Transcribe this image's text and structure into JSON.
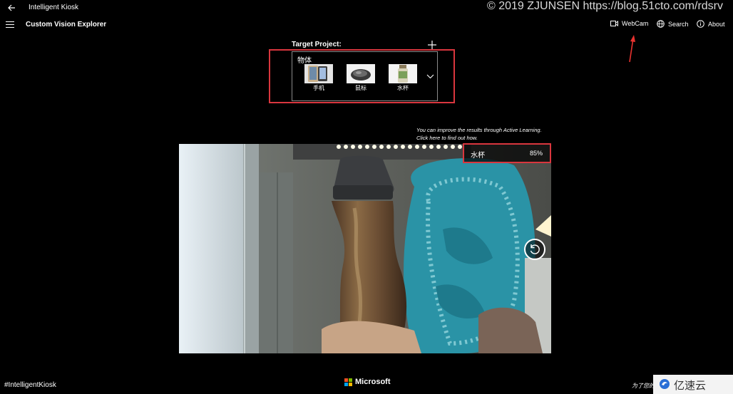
{
  "window": {
    "title": "Intelligent Kiosk",
    "watermark": "© 2019 ZJUNSEN https://blog.51cto.com/rdsrv"
  },
  "header": {
    "page_title": "Custom Vision Explorer",
    "nav": [
      {
        "label": "WebCam",
        "icon": "webcam-icon"
      },
      {
        "label": "Search",
        "icon": "globe-icon"
      },
      {
        "label": "About",
        "icon": "info-icon"
      }
    ]
  },
  "project": {
    "label": "Target Project:",
    "name": "物体",
    "tags": [
      {
        "label": "手机",
        "icon": "phone-thumbnail"
      },
      {
        "label": "鼠标",
        "icon": "mouse-thumbnail"
      },
      {
        "label": "水杯",
        "icon": "bottle-thumbnail"
      }
    ]
  },
  "active_learning": {
    "line1": "You can improve the results through Active Learning.",
    "line2": "Click here to find out how."
  },
  "result": {
    "label": "水杯",
    "score": "85%"
  },
  "footer": {
    "hashtag": "#IntelligentKiosk",
    "brand": "Microsoft",
    "note": "为了您的",
    "site": "亿速云"
  },
  "colors": {
    "highlight": "#d9363e",
    "ms_red": "#f25022",
    "ms_green": "#7fba00",
    "ms_blue": "#00a4ef",
    "ms_yellow": "#ffb900"
  }
}
